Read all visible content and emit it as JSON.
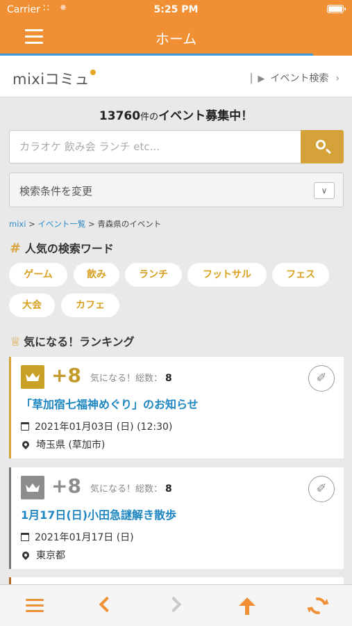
{
  "status_bar": {
    "carrier": "Carrier",
    "time": "5:25 PM",
    "battery_level": 1.0
  },
  "nav": {
    "title": "ホーム",
    "load_progress": 0.89
  },
  "header": {
    "logo_text": "mixiコミュ",
    "event_search_label": "イベント検索"
  },
  "summary": {
    "count": "13760",
    "unit": "件の",
    "label": "イベント募集中！"
  },
  "search": {
    "placeholder": "カラオケ 飲み会 ランチ etc...",
    "value": ""
  },
  "conditions": {
    "label": "検索条件を変更"
  },
  "breadcrumb": {
    "items": [
      "mixi",
      "イベント一覧",
      "青森県のイベント"
    ],
    "separator": ">"
  },
  "popular": {
    "title": "人気の検索ワード",
    "tags": [
      "ゲーム",
      "飲み",
      "ランチ",
      "フットサル",
      "フェス",
      "大会",
      "カフェ"
    ]
  },
  "ranking": {
    "title": "気になる！ランキング",
    "items": [
      {
        "plus": "+8",
        "total_label": "気になる！総数：",
        "total": "8",
        "title": "「草加宿七福神めぐり」のお知らせ",
        "date": "2021年01月03日 (日) (12:30)",
        "place": "埼玉県 (草加市)"
      },
      {
        "plus": "+8",
        "total_label": "気になる！総数：",
        "total": "8",
        "title": "1月17日(日)小田急謎解き散歩",
        "date": "2021年01月17日 (日)",
        "place": "東京都"
      }
    ]
  },
  "colors": {
    "brand": "#f08f33",
    "accent_gold": "#d5a23a",
    "link": "#1d86c2"
  },
  "icons": {
    "toolbar": [
      "menu-icon",
      "back-icon",
      "forward-icon",
      "scroll-top-icon",
      "refresh-icon"
    ]
  }
}
